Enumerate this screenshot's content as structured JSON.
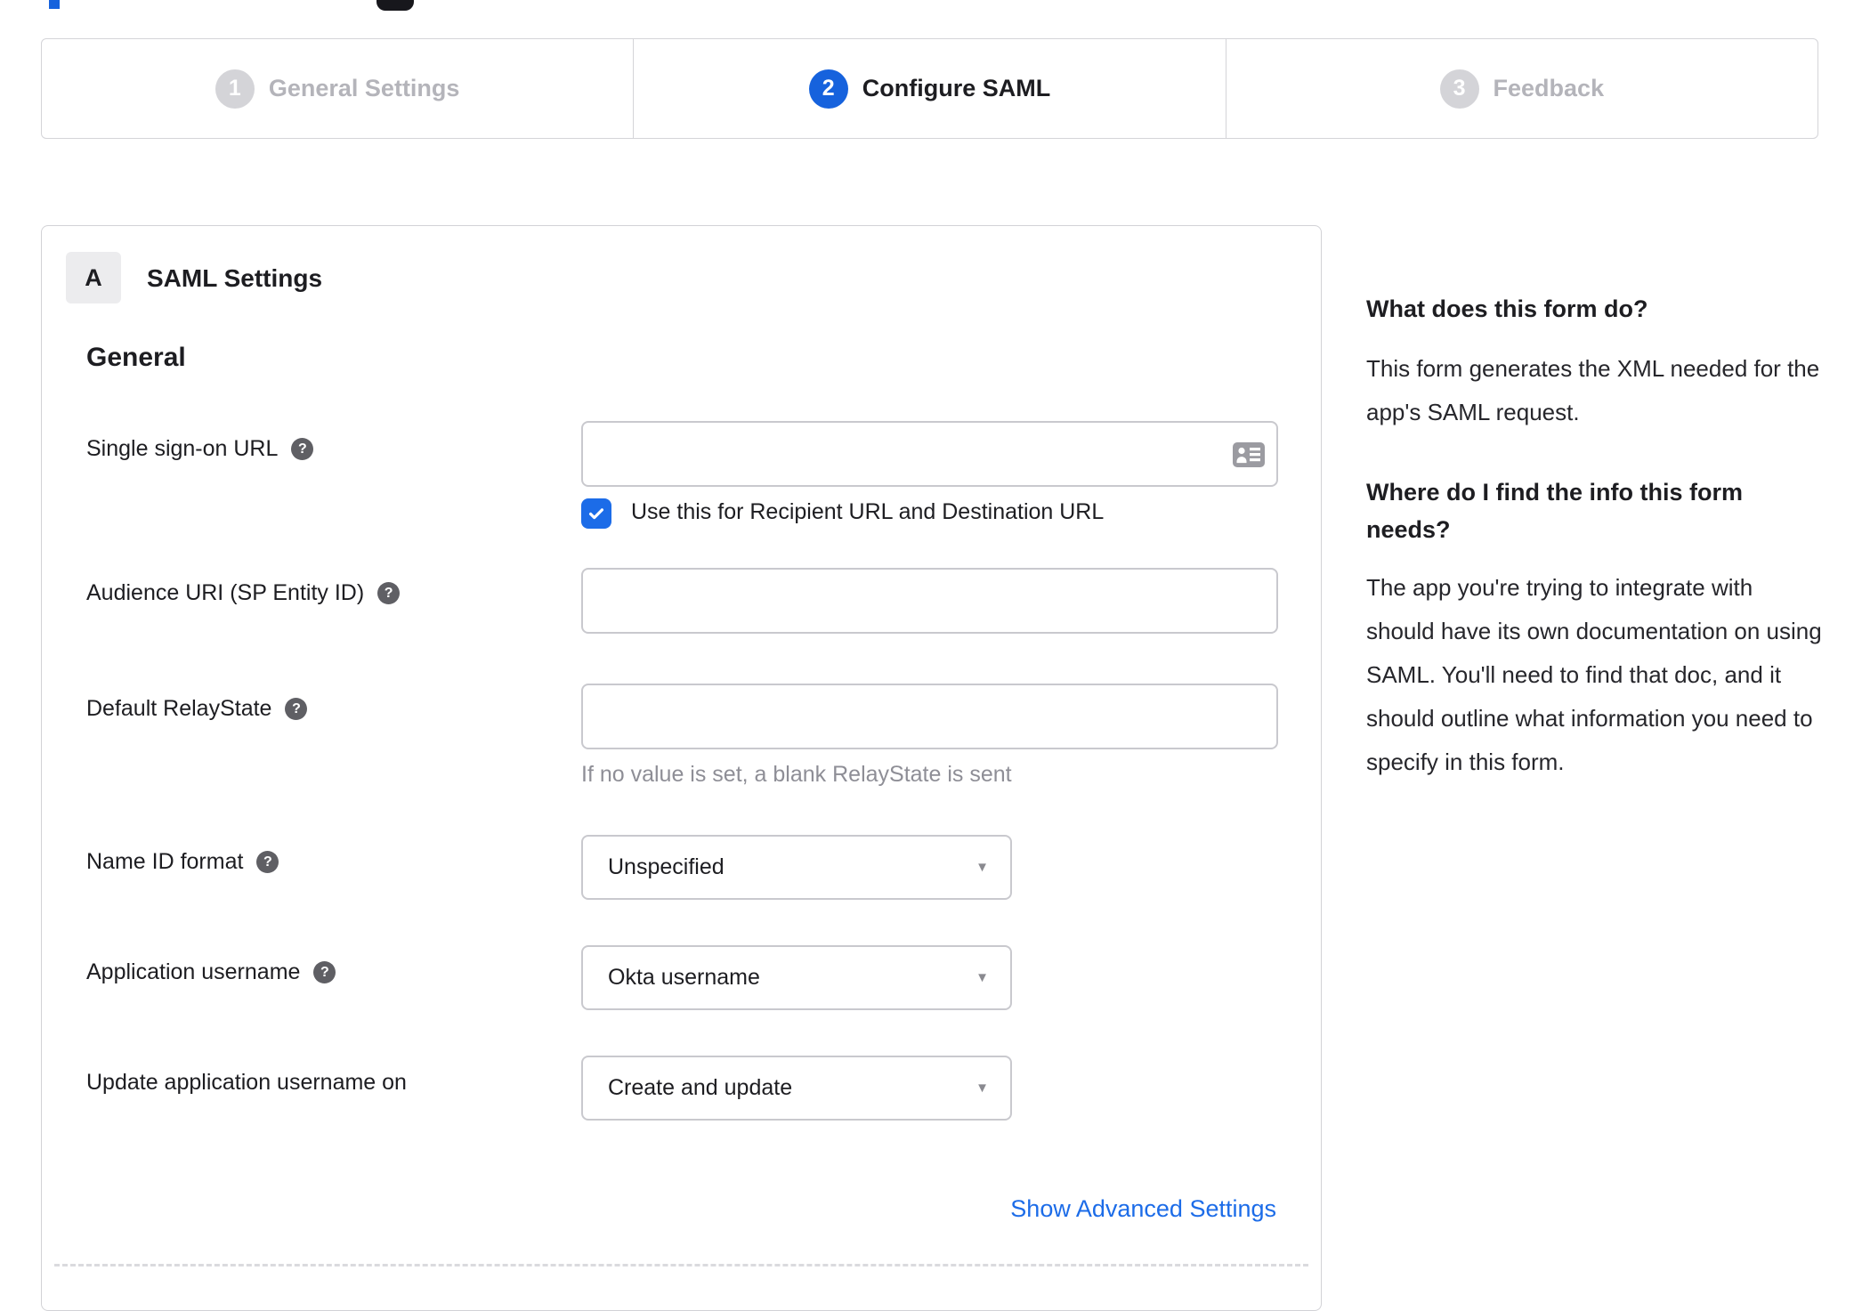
{
  "stepper": {
    "steps": [
      {
        "number": "1",
        "label": "General Settings",
        "active": false
      },
      {
        "number": "2",
        "label": "Configure SAML",
        "active": true
      },
      {
        "number": "3",
        "label": "Feedback",
        "active": false
      }
    ]
  },
  "panel": {
    "badge": "A",
    "title": "SAML Settings",
    "section": "General",
    "fields": {
      "sso": {
        "label": "Single sign-on URL",
        "value": ""
      },
      "sso_checkbox": {
        "label": "Use this for Recipient URL and Destination URL",
        "checked": true
      },
      "audience": {
        "label": "Audience URI (SP Entity ID)",
        "value": ""
      },
      "relay_state": {
        "label": "Default RelayState",
        "value": "",
        "hint": "If no value is set, a blank RelayState is sent"
      },
      "name_id_format": {
        "label": "Name ID format",
        "value": "Unspecified"
      },
      "app_username": {
        "label": "Application username",
        "value": "Okta username"
      },
      "update_username": {
        "label": "Update application username on",
        "value": "Create and update"
      }
    },
    "advanced_link": "Show Advanced Settings"
  },
  "sidebar": {
    "heading1": "What does this form do?",
    "body1": "This form generates the XML needed for the app's SAML request.",
    "heading2": "Where do I find the info this form needs?",
    "body2": "The app you're trying to integrate with should have its own documentation on using SAML. You'll need to find that doc, and it should outline what information you need to specify in this form."
  },
  "colors": {
    "accent": "#1662dd",
    "checkbox": "#1c6ce8",
    "link": "#1c6ce8"
  }
}
